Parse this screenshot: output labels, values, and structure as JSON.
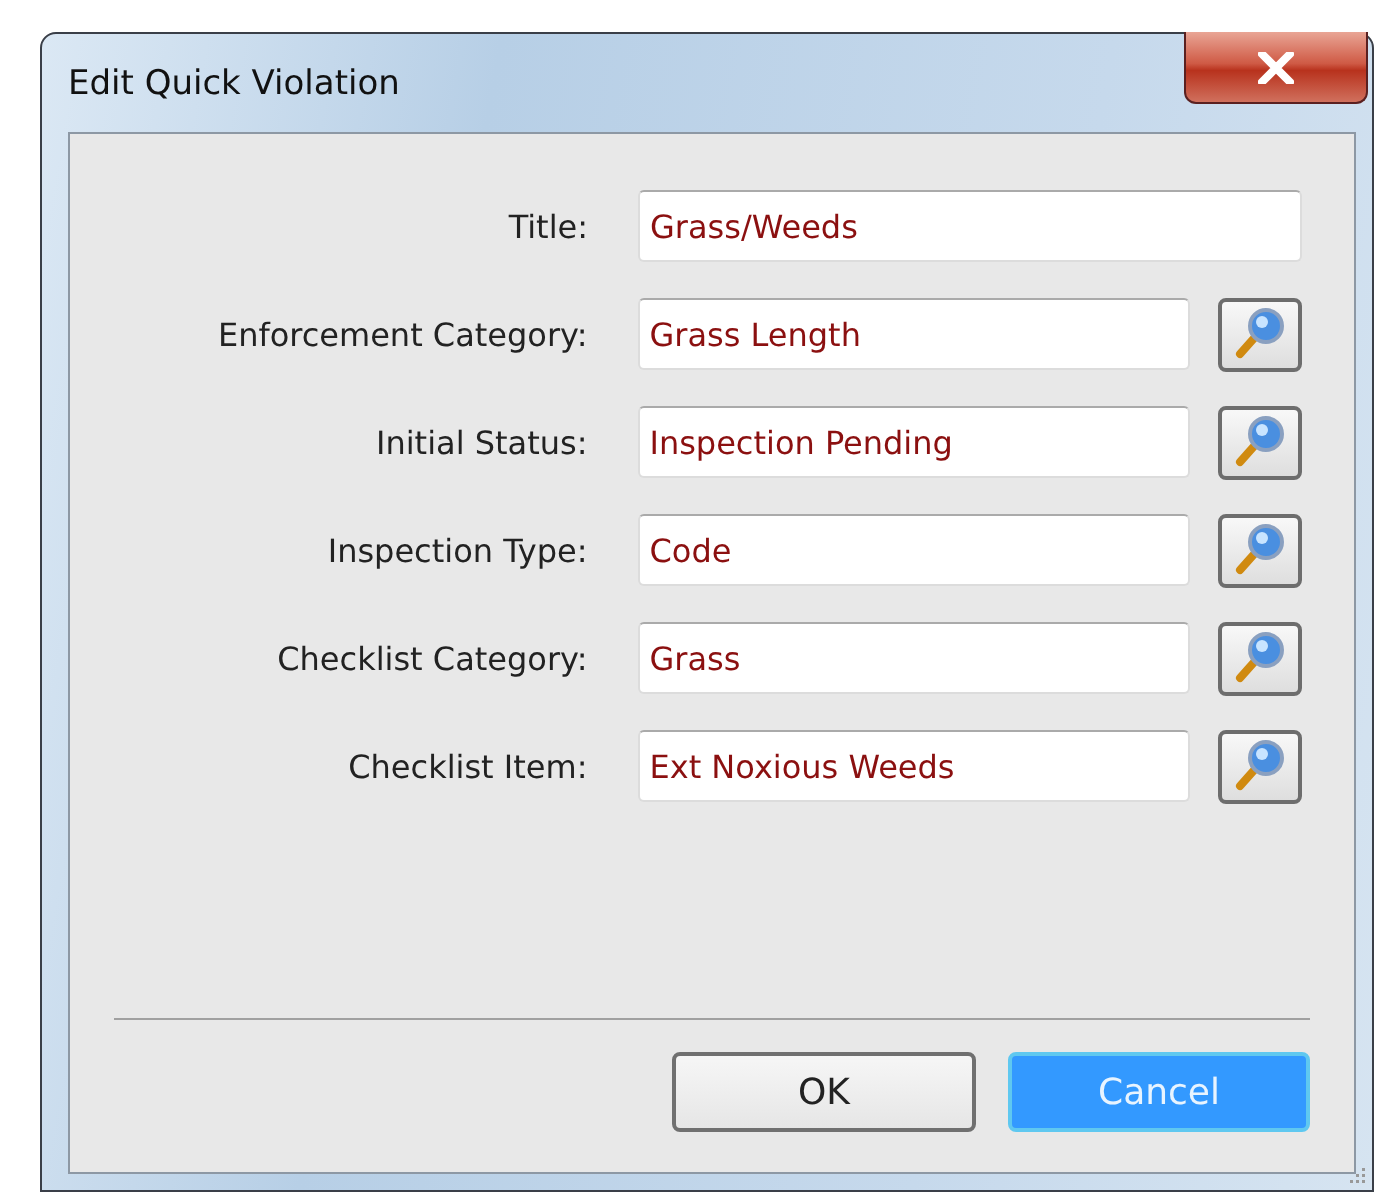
{
  "window": {
    "title": "Edit Quick Violation"
  },
  "fields": [
    {
      "label": "Title:",
      "value": "Grass/Weeds",
      "lookup": false
    },
    {
      "label": "Enforcement Category:",
      "value": "Grass Length",
      "lookup": true
    },
    {
      "label": "Initial Status:",
      "value": "Inspection Pending",
      "lookup": true
    },
    {
      "label": "Inspection Type:",
      "value": "Code",
      "lookup": true
    },
    {
      "label": "Checklist Category:",
      "value": "Grass",
      "lookup": true
    },
    {
      "label": "Checklist Item:",
      "value": "Ext Noxious Weeds",
      "lookup": true
    }
  ],
  "buttons": [
    {
      "label": "OK",
      "default": false
    },
    {
      "label": "Cancel",
      "default": true
    }
  ]
}
